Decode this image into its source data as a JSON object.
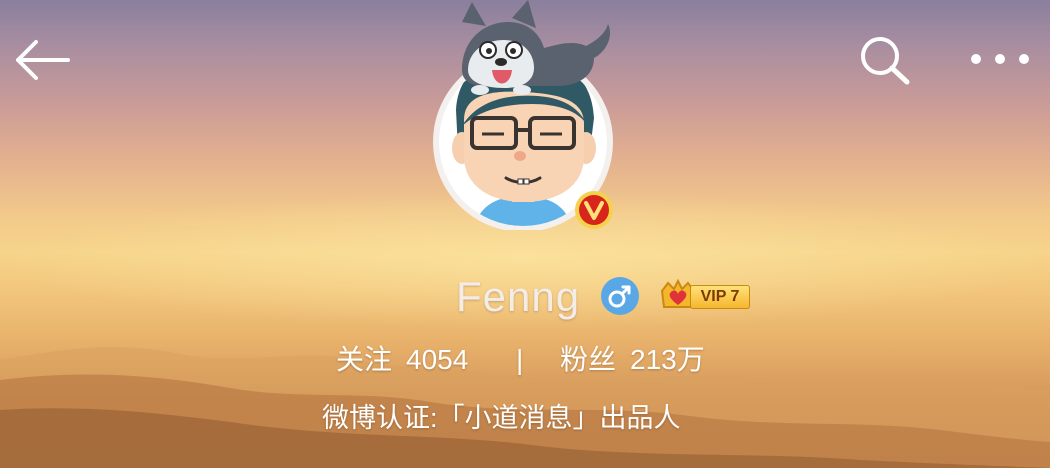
{
  "header": {
    "back_icon": "back-arrow-icon",
    "search_icon": "search-icon",
    "more_icon": "more-dots-icon"
  },
  "profile": {
    "username": "Fenng",
    "gender_icon": "male-icon",
    "verified_icon": "verified-v-icon",
    "vip_label": "VIP 7",
    "following_label": "关注",
    "following_count": "4054",
    "separator": "|",
    "fans_label": "粉丝",
    "fans_count": "213万",
    "verification": "微博认证:「小道消息」出品人"
  },
  "colors": {
    "gender_blue": "#5aa7e6",
    "verified_red": "#d8251b",
    "vip_gold": "#f5b62e"
  }
}
